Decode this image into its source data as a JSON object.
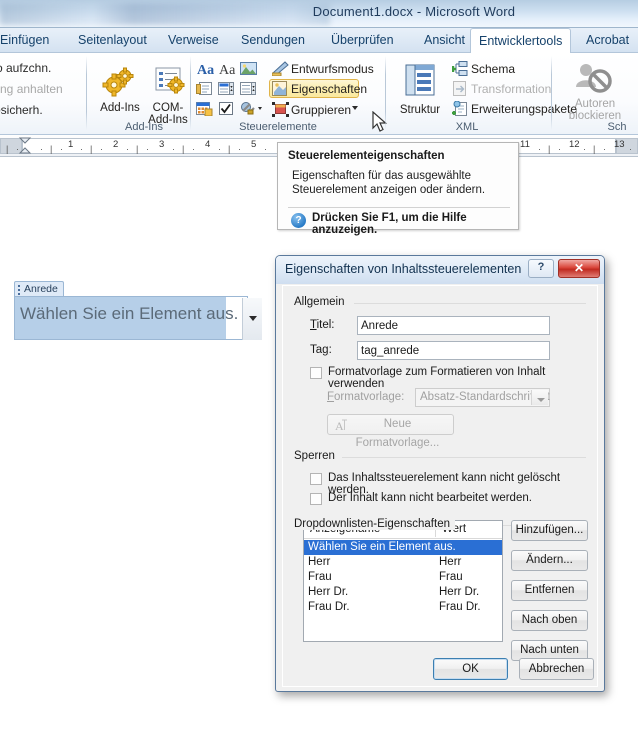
{
  "window": {
    "title": "Document1.docx  -  Microsoft Word"
  },
  "ribbon": {
    "tabs": [
      {
        "label": "Einfügen",
        "active": false
      },
      {
        "label": "Seitenlayout",
        "active": false
      },
      {
        "label": "Verweise",
        "active": false
      },
      {
        "label": "Sendungen",
        "active": false
      },
      {
        "label": "Überprüfen",
        "active": false
      },
      {
        "label": "Ansicht",
        "active": false
      },
      {
        "label": "Entwicklertools",
        "active": true
      },
      {
        "label": "Acrobat",
        "active": false
      }
    ],
    "code_group": {
      "item1": "kro aufzchn.",
      "item2": "fzchng anhalten",
      "item3": "krosicherh."
    },
    "addins_group": {
      "label": "Add-Ins",
      "addins_button": "Add-Ins",
      "com_addins_button_line1": "COM-",
      "com_addins_button_line2": "Add-Ins"
    },
    "controls_group": {
      "label": "Steuerelemente",
      "design_mode": "Entwurfsmodus",
      "properties": "Eigenschaften",
      "group": "Gruppieren",
      "icon_rich_text": "rich-text-content-control-icon",
      "icon_plain_text": "plain-text-content-control-icon",
      "icon_picture": "picture-content-control-icon",
      "icon_building_block": "building-block-gallery-icon",
      "icon_combo_box": "combo-box-content-control-icon",
      "icon_dropdown": "dropdown-list-content-control-icon",
      "icon_date_picker": "date-picker-content-control-icon",
      "icon_checkbox": "check-box-content-control-icon",
      "icon_legacy_tools": "legacy-tools-icon"
    },
    "xml_group": {
      "label": "XML",
      "structure": "Struktur",
      "schema": "Schema",
      "transformation": "Transformation",
      "expansion_packs": "Erweiterungspakete"
    },
    "protect_group": {
      "label": "Sch",
      "block_authors_line1": "Autoren",
      "block_authors_line2": "blockieren"
    }
  },
  "ruler": {
    "numbers": [
      "1",
      "2",
      "3",
      "4",
      "5",
      "11",
      "12",
      "13"
    ]
  },
  "document": {
    "content_control": {
      "tag_label": "Anrede",
      "placeholder_text": "Wählen Sie ein Element aus.",
      "dropdown_icon": "chevron-down-icon"
    }
  },
  "tooltip": {
    "title": "Steuerelementeigenschaften",
    "body_line1": "Eigenschaften für das ausgewählte",
    "body_line2": "Steuerelement anzeigen oder ändern.",
    "help_text": "Drücken Sie F1, um die Hilfe anzuzeigen.",
    "help_icon": "question-mark-icon"
  },
  "dialog": {
    "title": "Eigenschaften von Inhaltssteuerelementen",
    "help_button": "?",
    "close_button": "✕",
    "general": {
      "legend": "Allgemein",
      "title_label": "Titel:",
      "title_value": "Anrede",
      "tag_label": "Tag:",
      "tag_value": "tag_anrede",
      "use_style_checkbox": "Formatvorlage zum Formatieren von Inhalt verwenden",
      "use_style_checked": false,
      "style_label": "Formatvorlage:",
      "style_value": "Absatz-Standardschriftart",
      "new_style_button": "Neue Formatvorlage..."
    },
    "locking": {
      "legend": "Sperren",
      "cannot_delete_checkbox": "Das Inhaltssteuerelement kann nicht gelöscht werden.",
      "cannot_delete_checked": false,
      "cannot_edit_checkbox": "Der Inhalt kann nicht bearbeitet werden.",
      "cannot_edit_checked": false
    },
    "dropdown_properties": {
      "legend": "Dropdownlisten-Eigenschaften",
      "columns": [
        "Anzeigename",
        "Wert"
      ],
      "rows": [
        {
          "display": "Wählen Sie ein Element aus.",
          "value": "",
          "selected": true
        },
        {
          "display": "Herr",
          "value": "Herr",
          "selected": false
        },
        {
          "display": "Frau",
          "value": "Frau",
          "selected": false
        },
        {
          "display": "Herr Dr.",
          "value": "Herr Dr.",
          "selected": false
        },
        {
          "display": "Frau Dr.",
          "value": "Frau Dr.",
          "selected": false
        }
      ],
      "buttons": {
        "add": "Hinzufügen...",
        "modify": "Ändern...",
        "remove": "Entfernen",
        "move_up": "Nach oben",
        "move_down": "Nach unten"
      }
    },
    "footer": {
      "ok": "OK",
      "cancel": "Abbrechen"
    }
  },
  "colors": {
    "accent_blue": "#2a6fd4",
    "highlight_yellow": "#fceeae",
    "content_control_fill": "#b6cfe8",
    "close_red": "#d9453a"
  }
}
